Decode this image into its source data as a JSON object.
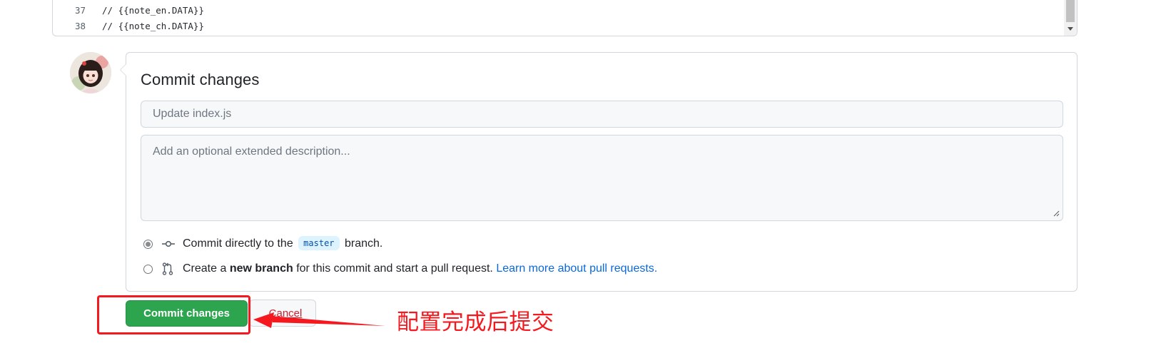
{
  "editor": {
    "lines": [
      {
        "number": "37",
        "code": "// {{note_en.DATA}}"
      },
      {
        "number": "38",
        "code": "// {{note_ch.DATA}}"
      }
    ]
  },
  "commit": {
    "title": "Commit changes",
    "summary_placeholder": "Update index.js",
    "description_placeholder": "Add an optional extended description...",
    "options": {
      "direct": {
        "selected": true,
        "text_before": "Commit directly to the",
        "branch": "master",
        "text_after": "branch."
      },
      "new_branch": {
        "selected": false,
        "text_before": "Create a",
        "bold": "new branch",
        "text_after": "for this commit and start a pull request.",
        "link": "Learn more about pull requests."
      }
    },
    "commit_button": "Commit changes",
    "cancel_button": "Cancel"
  },
  "annotation": {
    "text": "配置完成后提交",
    "color": "#f5181e"
  },
  "colors": {
    "primary_button": "#2da44e",
    "link": "#0969da",
    "danger": "#cf222e"
  }
}
